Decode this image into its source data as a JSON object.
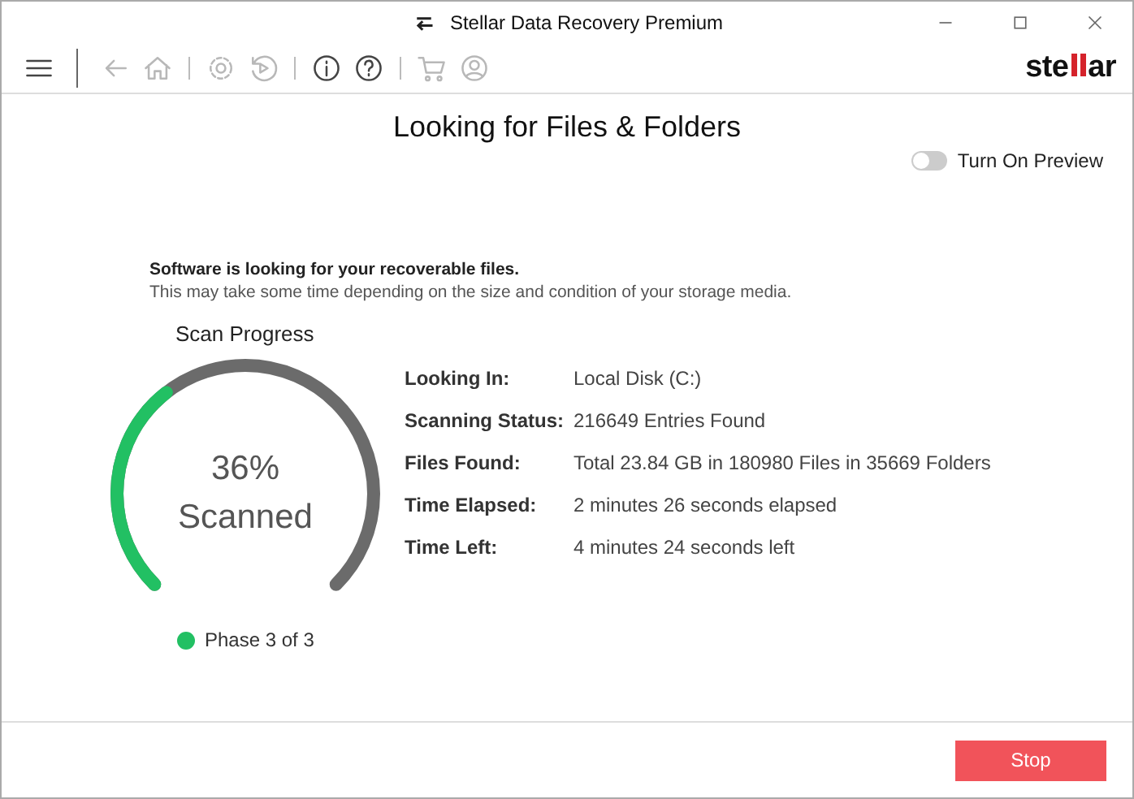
{
  "window": {
    "title": "Stellar Data Recovery Premium",
    "controls": [
      {
        "kind": "minimize"
      },
      {
        "kind": "maximize"
      },
      {
        "kind": "close"
      }
    ]
  },
  "toolbar": {
    "items": [
      {
        "kind": "menu",
        "disabled": false
      },
      {
        "kind": "separator"
      },
      {
        "kind": "back",
        "disabled": true
      },
      {
        "kind": "home",
        "disabled": true
      },
      {
        "kind": "separator"
      },
      {
        "kind": "settings",
        "disabled": true
      },
      {
        "kind": "history",
        "disabled": true
      },
      {
        "kind": "separator"
      },
      {
        "kind": "info",
        "disabled": false
      },
      {
        "kind": "help",
        "disabled": false
      },
      {
        "kind": "separator"
      },
      {
        "kind": "cart",
        "disabled": true
      },
      {
        "kind": "user",
        "disabled": true
      }
    ],
    "logo": {
      "left": "ste",
      "right": "ar"
    }
  },
  "heading": "Looking for Files & Folders",
  "preview_toggle": {
    "label": "Turn On Preview",
    "on": false
  },
  "message": {
    "title": "Software is looking for your recoverable files.",
    "detail": "This may take some time depending on the size and condition of your storage media."
  },
  "progress": {
    "title": "Scan Progress",
    "percent": "36%",
    "caption": "Scanned",
    "phase": "Phase 3 of 3"
  },
  "details": [
    {
      "label": "Looking In:",
      "value": "Local Disk (C:)"
    },
    {
      "label": "Scanning Status:",
      "value": "216649 Entries Found"
    },
    {
      "label": "Files Found:",
      "value": "Total 23.84 GB in 180980 Files in 35669 Folders"
    },
    {
      "label": "Time Elapsed:",
      "value": "2 minutes 26 seconds elapsed"
    },
    {
      "label": "Time Left:",
      "value": "4 minutes 24 seconds left"
    }
  ],
  "buttons": [
    {
      "label": "Stop"
    }
  ]
}
